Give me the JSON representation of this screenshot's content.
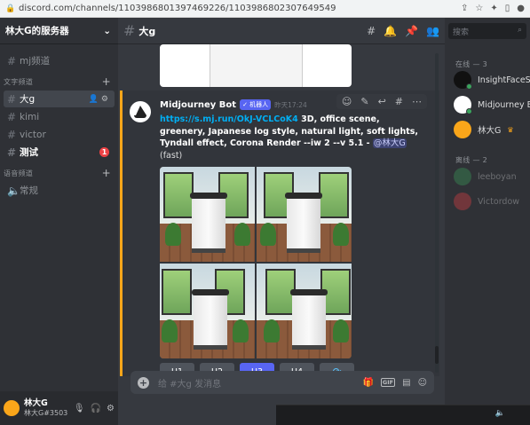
{
  "browser": {
    "url": "discord.com/channels/1103986801397469226/1103986802307649549"
  },
  "server": {
    "name": "林大G的服务器"
  },
  "sidebar": {
    "channels_top": [
      {
        "label": "mj频道"
      }
    ],
    "text_category": "文字频道",
    "text_channels": [
      {
        "label": "大g",
        "active": true
      },
      {
        "label": "kimi"
      },
      {
        "label": "victor"
      },
      {
        "label": "测试",
        "badge": "1"
      }
    ],
    "voice_category": "语音频道",
    "voice_channels": [
      {
        "label": "常规"
      }
    ]
  },
  "user": {
    "name": "林大G",
    "tag": "林大G#3503"
  },
  "channel": {
    "title": "大g"
  },
  "message": {
    "author": "Midjourney Bot",
    "bot_badge": "✓ 机器人",
    "timestamp": "昨天17:24",
    "link": "https://s.mj.run/OkJ-VCLCoK4",
    "prompt_text": " 3D, office scene, greenery, Japanese log style, natural light, soft lights, Tyndall effect, Corona Render --iw 2 --v 5.1 - ",
    "mention": "@林大G",
    "suffix": " (fast)",
    "buttons": [
      {
        "label": "U1"
      },
      {
        "label": "U2"
      },
      {
        "label": "U3",
        "active": true
      },
      {
        "label": "U4"
      },
      {
        "label": "⟳"
      }
    ]
  },
  "composer": {
    "placeholder": "给 #大g 发消息",
    "gif": "GIF"
  },
  "members": {
    "search_placeholder": "搜索",
    "online_header": "在线 — 3",
    "online": [
      {
        "name": "InsightFaceS...",
        "color": "#111111"
      },
      {
        "name": "Midjourney B...",
        "color": "#ffffff"
      },
      {
        "name": "林大G",
        "color": "#faa61a",
        "crown": "♛"
      }
    ],
    "offline_header": "离线 — 2",
    "offline": [
      {
        "name": "leeboyan",
        "color": "#3ba55d"
      },
      {
        "name": "Victordow",
        "color": "#ed4245"
      }
    ]
  }
}
